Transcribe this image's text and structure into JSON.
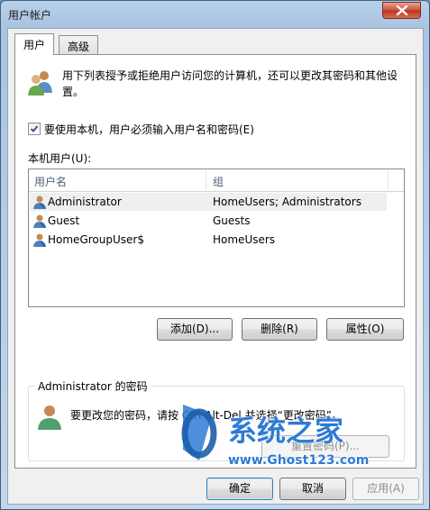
{
  "window": {
    "title": "用户帐户"
  },
  "tabs": [
    {
      "label": "用户"
    },
    {
      "label": "高级"
    }
  ],
  "description": "用下列表授予或拒绝用户访问您的计算机，还可以更改其密码和其他设置。",
  "must_login": {
    "label": "要使用本机，用户必须输入用户名和密码(E)",
    "checked": true
  },
  "users_section": {
    "label": "本机用户(U):",
    "columns": [
      "用户名",
      "组"
    ],
    "rows": [
      {
        "name": "Administrator",
        "group": "HomeUsers; Administrators"
      },
      {
        "name": "Guest",
        "group": "Guests"
      },
      {
        "name": "HomeGroupUser$",
        "group": "HomeUsers"
      }
    ]
  },
  "list_buttons": {
    "add": "添加(D)...",
    "remove": "删除(R)",
    "properties": "属性(O)"
  },
  "password_box": {
    "title": "Administrator 的密码",
    "text": "要更改您的密码，请按 Ctrl-Alt-Del 并选择“更改密码”。",
    "reset_label": "重置密码(P)..."
  },
  "dialog_buttons": {
    "ok": "确定",
    "cancel": "取消",
    "apply": "应用(A)"
  },
  "watermark": {
    "brand": "系统之家",
    "url": "www.Ghost123.com"
  },
  "colors": {
    "accent": "#3c7fb1",
    "title_bar": "#b9d1ea",
    "close": "#c7513b",
    "watermark_blue": "#2e7bd4"
  }
}
